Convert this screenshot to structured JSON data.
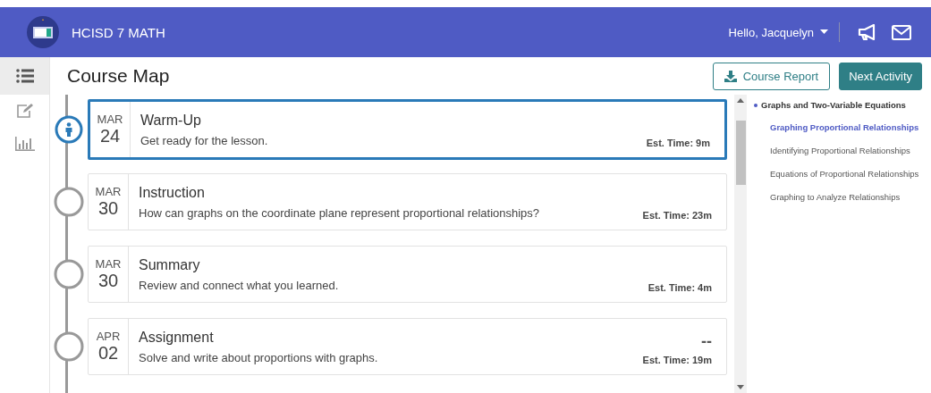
{
  "header": {
    "title": "HCISD 7 MATH",
    "greeting": "Hello, Jacquelyn"
  },
  "sidebar": {
    "items": [
      {
        "kind": "list",
        "selected": true
      },
      {
        "kind": "edit",
        "selected": false
      },
      {
        "kind": "chart",
        "selected": false
      }
    ]
  },
  "page": {
    "title": "Course Map",
    "buttons": [
      {
        "kind": "outline",
        "label": "Course Report"
      },
      {
        "kind": "primary",
        "label": "Next Activity"
      }
    ]
  },
  "activities": [
    {
      "month": "MAR",
      "day": "24",
      "title": "Warm-Up",
      "description": "Get ready for the lesson.",
      "time": "Est. Time: 9m",
      "selected": true
    },
    {
      "month": "MAR",
      "day": "30",
      "title": "Instruction",
      "description": "How can graphs on the coordinate plane represent proportional relationships?",
      "time": "Est. Time: 23m",
      "selected": false
    },
    {
      "month": "MAR",
      "day": "30",
      "title": "Summary",
      "description": "Review and connect what you learned.",
      "time": "Est. Time: 4m",
      "selected": false
    },
    {
      "month": "APR",
      "day": "02",
      "title": "Assignment",
      "description": "Solve and write about proportions with graphs.",
      "score": "--",
      "time": "Est. Time: 19m",
      "selected": false
    }
  ],
  "outline": {
    "unit": "Graphs and Two-Variable Equations",
    "lessons": [
      {
        "label": "Graphing Proportional Relationships",
        "selected": true
      },
      {
        "label": "Identifying Proportional Relationships",
        "selected": false
      },
      {
        "label": "Equations of Proportional Relationships",
        "selected": false
      },
      {
        "label": "Graphing to Analyze Relationships",
        "selected": false
      }
    ]
  }
}
